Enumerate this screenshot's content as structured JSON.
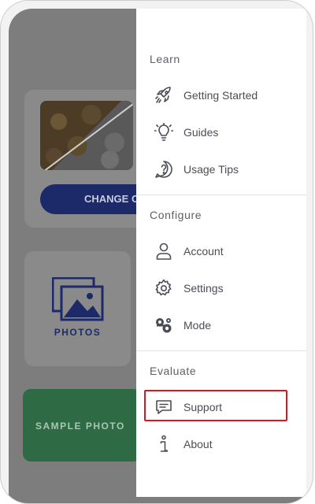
{
  "background": {
    "change_button_label": "CHANGE CO",
    "photos_label": "PHOTOS",
    "sample_button_label": "SAMPLE PHOTO"
  },
  "drawer": {
    "sections": [
      {
        "title": "Learn",
        "items": [
          {
            "label": "Getting Started",
            "icon": "rocket-icon"
          },
          {
            "label": "Guides",
            "icon": "lightbulb-icon"
          },
          {
            "label": "Usage Tips",
            "icon": "question-circle-icon"
          }
        ]
      },
      {
        "title": "Configure",
        "items": [
          {
            "label": "Account",
            "icon": "user-icon"
          },
          {
            "label": "Settings",
            "icon": "gear-icon"
          },
          {
            "label": "Mode",
            "icon": "gears-mode-icon"
          }
        ]
      },
      {
        "title": "Evaluate",
        "items": [
          {
            "label": "Support",
            "icon": "chat-bubble-icon"
          },
          {
            "label": "About",
            "icon": "info-icon"
          }
        ]
      }
    ],
    "highlighted_item": "Support"
  },
  "colors": {
    "accent_dark_blue": "#1c2a6a",
    "sample_green": "#2e6b45",
    "highlight_red": "#e0141c",
    "overlay_gray": "#7d7d7d"
  }
}
